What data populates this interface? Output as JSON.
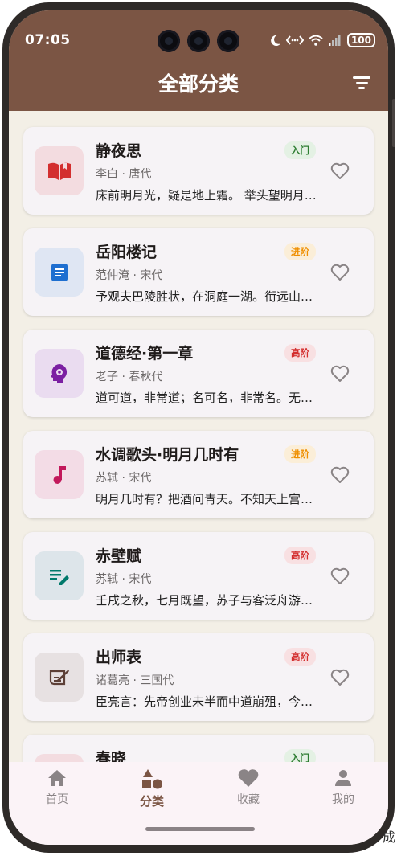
{
  "status": {
    "time": "07:05",
    "battery": "100"
  },
  "header": {
    "title": "全部分类"
  },
  "cards": [
    {
      "title": "静夜思",
      "meta": "李白 · 唐代",
      "excerpt": "床前明月光，疑是地上霜。 举头望明月，低头思故乡。",
      "badge": "入门",
      "icon": "book-open-icon",
      "icon_color": "#d32f2f",
      "icon_bg": "#f3dce0",
      "badge_bg": "#e4f1e4",
      "badge_color": "#2e7d32"
    },
    {
      "title": "岳阳楼记",
      "meta": "范仲淹 · 宋代",
      "excerpt": "予观夫巴陵胜状，在洞庭一湖。衔远山，吞长江。",
      "badge": "进阶",
      "icon": "document-icon",
      "icon_color": "#1e6fd0",
      "icon_bg": "#dfe6f3",
      "badge_bg": "#fbeed8",
      "badge_color": "#ef8f00"
    },
    {
      "title": "道德经·第一章",
      "meta": "老子 · 春秋代",
      "excerpt": "道可道，非常道；名可名，非常名。无名天地之始。",
      "badge": "高阶",
      "icon": "mind-gear-icon",
      "icon_color": "#7b1fa2",
      "icon_bg": "#eadcf0",
      "badge_bg": "#f8e0e2",
      "badge_color": "#d32f2f"
    },
    {
      "title": "水调歌头·明月几时有",
      "meta": "苏轼 · 宋代",
      "excerpt": "明月几时有？把酒问青天。不知天上宫阙，今夕是何年。",
      "badge": "进阶",
      "icon": "music-note-icon",
      "icon_color": "#c2185b",
      "icon_bg": "#f3dce6",
      "badge_bg": "#fbeed8",
      "badge_color": "#ef8f00"
    },
    {
      "title": "赤壁赋",
      "meta": "苏轼 · 宋代",
      "excerpt": "壬戌之秋，七月既望，苏子与客泛舟游于赤壁之下。",
      "badge": "高阶",
      "icon": "edit-notes-icon",
      "icon_color": "#00796b",
      "icon_bg": "#dde5ea",
      "badge_bg": "#f8e0e2",
      "badge_color": "#d32f2f"
    },
    {
      "title": "出师表",
      "meta": "诸葛亮 · 三国代",
      "excerpt": "臣亮言：先帝创业未半而中道崩殂，今天下三分。",
      "badge": "高阶",
      "icon": "scroll-quill-icon",
      "icon_color": "#5d4037",
      "icon_bg": "#e7e1e2",
      "badge_bg": "#f8e0e2",
      "badge_color": "#d32f2f"
    },
    {
      "title": "春晓",
      "meta": "",
      "excerpt": "",
      "badge": "入门",
      "icon": "",
      "icon_color": "#d32f2f",
      "icon_bg": "#f3dce0",
      "badge_bg": "#e4f1e4",
      "badge_color": "#2e7d32"
    }
  ],
  "nav": [
    {
      "label": "首页",
      "icon": "home-icon"
    },
    {
      "label": "分类",
      "icon": "category-icon"
    },
    {
      "label": "收藏",
      "icon": "heart-icon"
    },
    {
      "label": "我的",
      "icon": "person-icon"
    }
  ],
  "overlay_text": "成"
}
